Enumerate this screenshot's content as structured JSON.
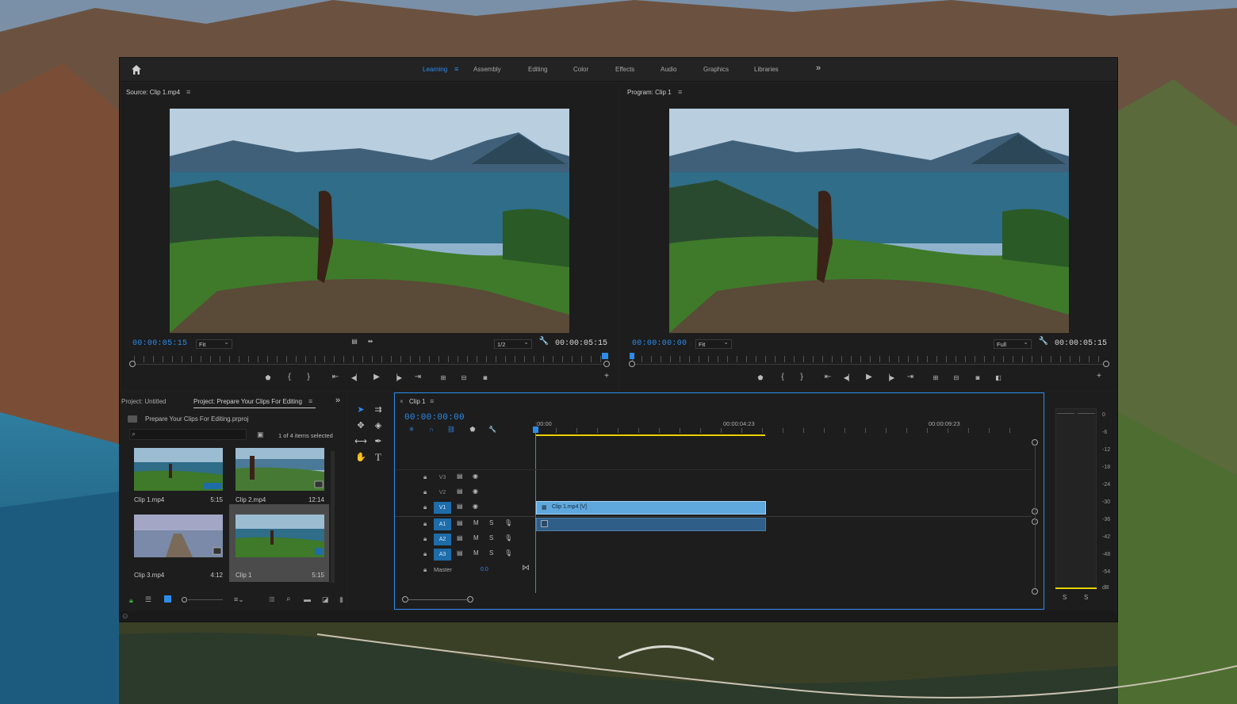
{
  "workspaces": [
    {
      "label": "Learning",
      "active": true
    },
    {
      "label": "Assembly",
      "active": false
    },
    {
      "label": "Editing",
      "active": false
    },
    {
      "label": "Color",
      "active": false
    },
    {
      "label": "Effects",
      "active": false
    },
    {
      "label": "Audio",
      "active": false
    },
    {
      "label": "Graphics",
      "active": false
    },
    {
      "label": "Libraries",
      "active": false
    }
  ],
  "source": {
    "title": "Source: Clip 1.mp4",
    "timecode": "00:00:05:15",
    "zoom": "Fit",
    "resolution": "1/2",
    "duration": "00:00:05:15",
    "playhead_fraction": 1.0
  },
  "program": {
    "title": "Program: Clip 1",
    "timecode": "00:00:00:00",
    "zoom": "Fit",
    "resolution": "Full",
    "duration": "00:00:05:15",
    "playhead_fraction": 0.0
  },
  "project": {
    "tab_untitled": "Project: Untitled",
    "tab_active": "Project: Prepare Your Clips For Editing",
    "file": "Prepare Your Clips For Editing.prproj",
    "search_placeholder": "",
    "selection_status": "1 of 4 items selected",
    "items": [
      {
        "name": "Clip 1.mp4",
        "duration": "5:15"
      },
      {
        "name": "Clip 2.mp4",
        "duration": "12:14"
      },
      {
        "name": "Clip 3.mp4",
        "duration": "4:12"
      },
      {
        "name": "Clip 1",
        "duration": "5:15",
        "selected": true
      }
    ]
  },
  "timeline": {
    "sequence": "Clip 1",
    "timecode": "00:00:00:00",
    "ruler": [
      ":00:00",
      "00:00:04:23",
      "00:00:09:23"
    ],
    "tracks": [
      {
        "name": "V3",
        "type": "video",
        "active": false
      },
      {
        "name": "V2",
        "type": "video",
        "active": false
      },
      {
        "name": "V1",
        "type": "video",
        "active": true
      },
      {
        "name": "A1",
        "type": "audio",
        "active": true
      },
      {
        "name": "A2",
        "type": "audio",
        "active": true
      },
      {
        "name": "A3",
        "type": "audio",
        "active": true
      }
    ],
    "master_label": "Master",
    "master_value": "0.0",
    "clip_label": "Clip 1.mp4 [V]",
    "mute_label": "M",
    "solo_label": "S"
  },
  "meter": {
    "scale": [
      "0",
      "-6",
      "-12",
      "-18",
      "-24",
      "-30",
      "-36",
      "-42",
      "-48",
      "-54",
      "dB"
    ],
    "solo_left": "S",
    "solo_right": "S"
  },
  "colors": {
    "accent": "#2d8ceb",
    "clip": "#5fa8dd",
    "work_area": "#e8d200"
  }
}
